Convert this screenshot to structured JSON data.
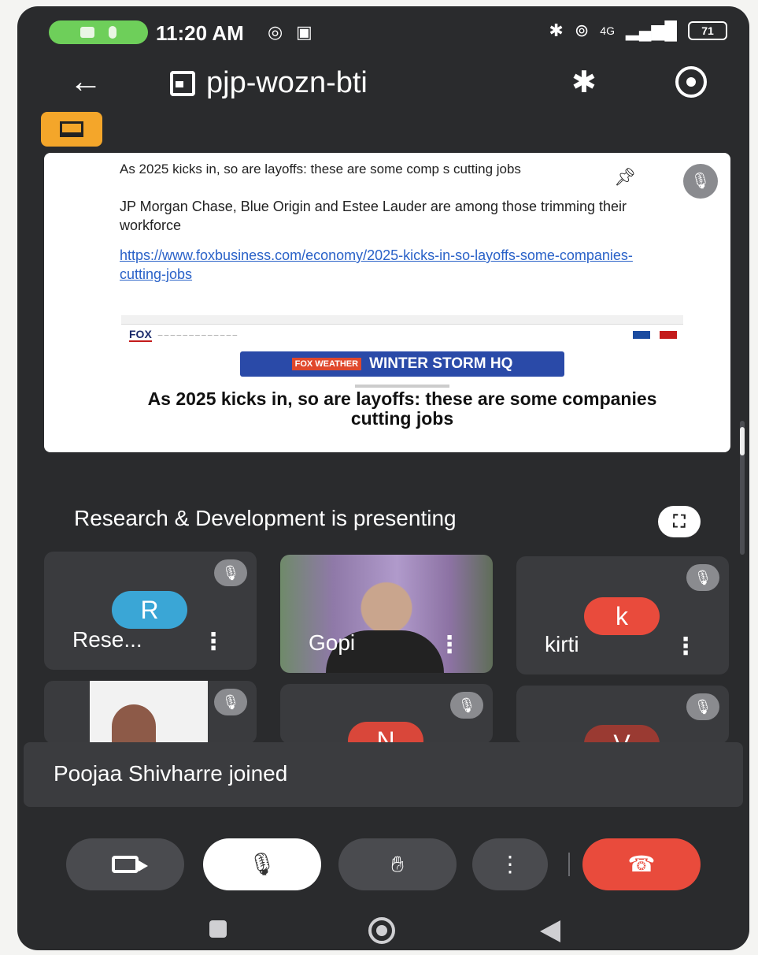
{
  "status_bar": {
    "time": "11:20 AM",
    "network": "4G",
    "battery": "71"
  },
  "header": {
    "room_code": "pjp-wozn-bti"
  },
  "presentation": {
    "title": "As 2025 kicks in, so are layoffs: these are some comp    s cutting jobs",
    "subtitle": "JP Morgan Chase, Blue Origin and Estee Lauder are among those trimming their workforce",
    "link": "https://www.foxbusiness.com/economy/2025-kicks-in-so-layoffs-some-companies-cutting-jobs",
    "screenshot": {
      "logo": "FOX",
      "banner_small": "FOX WEATHER",
      "banner": "WINTER STORM HQ",
      "headline": "As 2025 kicks in, so are layoffs: these are some companies cutting jobs"
    }
  },
  "presenting_text": "Research & Development is presenting",
  "participants": [
    {
      "name": "Rese...",
      "initial": "R",
      "avatar_color": "#3aa6d6"
    },
    {
      "name": "Gopi",
      "initial": "",
      "avatar_color": ""
    },
    {
      "name": "kirti",
      "initial": "k",
      "avatar_color": "#e94b3c"
    },
    {
      "name": "",
      "initial": "",
      "avatar_color": ""
    },
    {
      "name": "",
      "initial": "N",
      "avatar_color": "#d9473a"
    },
    {
      "name": "",
      "initial": "V",
      "avatar_color": "#9a3a32"
    }
  ],
  "toast": "Poojaa Shivharre joined",
  "colors": {
    "background": "#2a2b2d",
    "accent_orange": "#f4a62a",
    "end_call_red": "#e94b3c",
    "link_blue": "#2a62c8"
  }
}
